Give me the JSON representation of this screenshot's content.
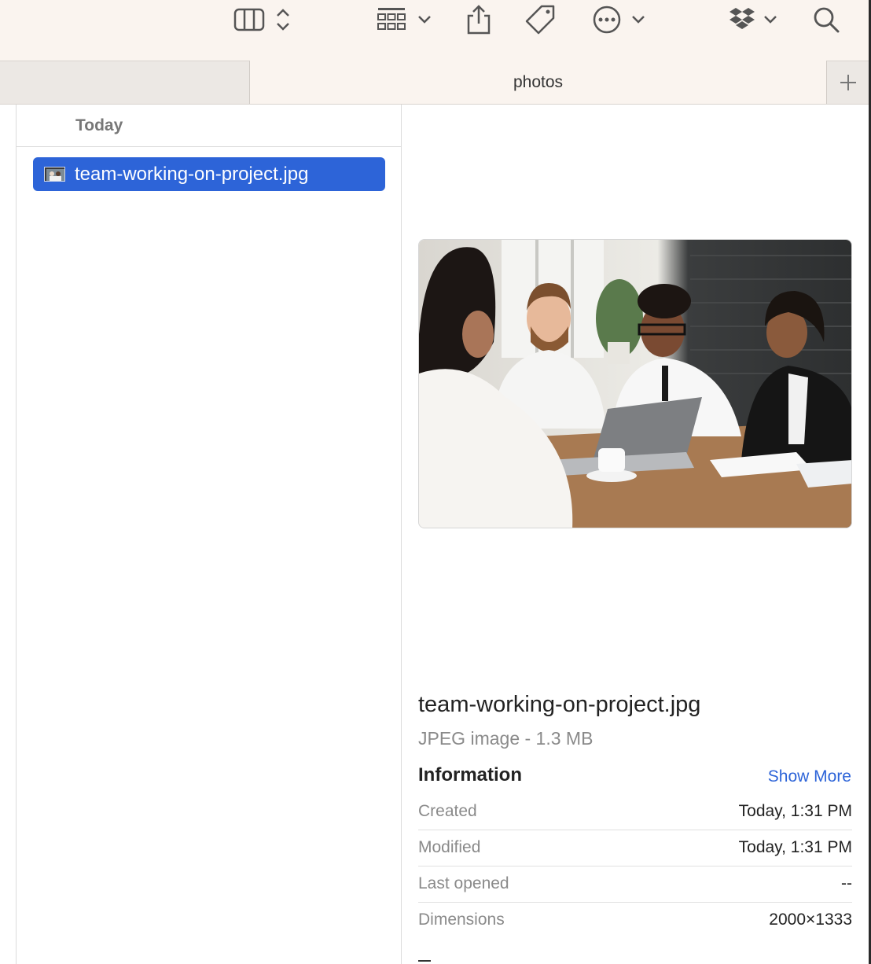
{
  "toolbar": {
    "icons": [
      "columns-view-icon",
      "updown-chevron-icon",
      "group-grid-icon",
      "chevron-down-icon",
      "share-icon",
      "tag-icon",
      "more-icon",
      "chevron-down-icon",
      "dropbox-icon",
      "chevron-down-icon",
      "search-icon"
    ]
  },
  "tabs": {
    "active_label": "photos",
    "add_label": "+"
  },
  "file_list": {
    "group_label": "Today",
    "items": [
      {
        "name": "team-working-on-project.jpg",
        "selected": true
      }
    ]
  },
  "preview": {
    "file_name": "team-working-on-project.jpg",
    "kind_size": "JPEG image - 1.3 MB",
    "info_heading": "Information",
    "show_more": "Show More",
    "rows": [
      {
        "label": "Created",
        "value": "Today, 1:31 PM"
      },
      {
        "label": "Modified",
        "value": "Today, 1:31 PM"
      },
      {
        "label": "Last opened",
        "value": "--"
      },
      {
        "label": "Dimensions",
        "value": "2000×1333"
      }
    ]
  },
  "colors": {
    "selection": "#2d64d8",
    "toolbar_bg": "#faf4ef",
    "link": "#2d64d8"
  }
}
